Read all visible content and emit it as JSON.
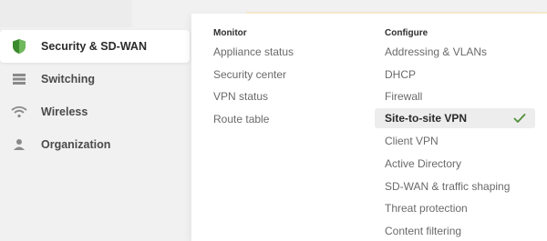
{
  "sidebar": {
    "items": [
      {
        "label": "Security & SD-WAN",
        "icon": "shield-icon",
        "active": true
      },
      {
        "label": "Switching",
        "icon": "switch-icon",
        "active": false
      },
      {
        "label": "Wireless",
        "icon": "wifi-icon",
        "active": false
      },
      {
        "label": "Organization",
        "icon": "organization-icon",
        "active": false
      }
    ]
  },
  "menu": {
    "monitor": {
      "heading": "Monitor",
      "links": [
        "Appliance status",
        "Security center",
        "VPN status",
        "Route table"
      ]
    },
    "configure": {
      "heading": "Configure",
      "links": [
        "Addressing & VLANs",
        "DHCP",
        "Firewall",
        "Site-to-site VPN",
        "Client VPN",
        "Active Directory",
        "SD-WAN & traffic shaping",
        "Threat protection",
        "Content filtering"
      ],
      "selected_index": 3,
      "selected_icon": "check-icon"
    }
  },
  "colors": {
    "shield_accent": "#3c8a2e",
    "check": "#4f8f3a",
    "selected_bg": "#ededed"
  }
}
